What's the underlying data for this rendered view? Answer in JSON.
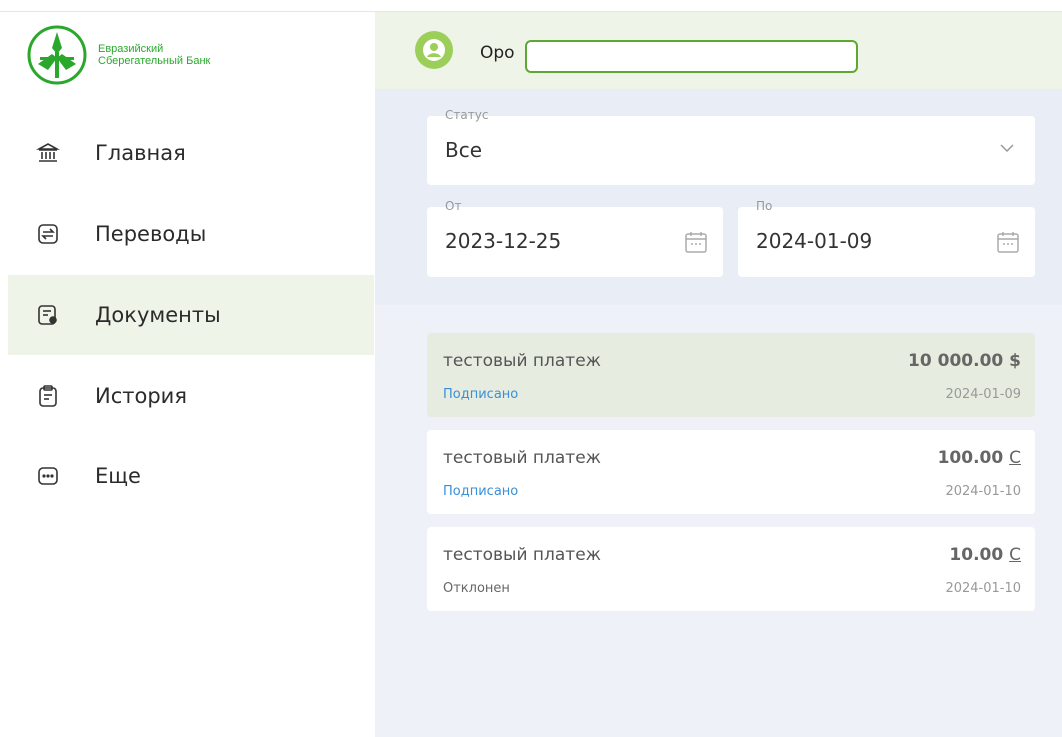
{
  "bank": {
    "name_line1": "Евразийский",
    "name_line2": "Сберегательный Банк",
    "brand_color": "#2aa82c"
  },
  "sidebar": {
    "items": [
      {
        "label": "Главная",
        "icon": "bank-icon",
        "active": false
      },
      {
        "label": "Переводы",
        "icon": "transfer-icon",
        "active": false
      },
      {
        "label": "Документы",
        "icon": "document-icon",
        "active": true
      },
      {
        "label": "История",
        "icon": "history-icon",
        "active": false
      },
      {
        "label": "Еще",
        "icon": "more-icon",
        "active": false
      }
    ]
  },
  "header": {
    "user_name": "Оро",
    "avatar_icon": "user-icon"
  },
  "filters": {
    "status": {
      "label": "Статус",
      "value": "Все"
    },
    "from": {
      "label": "От",
      "value": "2023-12-25"
    },
    "to": {
      "label": "По",
      "value": "2024-01-09"
    }
  },
  "payments": [
    {
      "title": "тестовый платеж",
      "amount": "10 000.00",
      "currency": "$",
      "status": "Подписано",
      "date": "2024-01-09",
      "selected": true
    },
    {
      "title": "тестовый платеж",
      "amount": "100.00",
      "currency": "С",
      "status": "Подписано",
      "date": "2024-01-10",
      "selected": false
    },
    {
      "title": "тестовый платеж",
      "amount": "10.00",
      "currency": "С",
      "status": "Отклонен",
      "date": "2024-01-10",
      "selected": false
    }
  ]
}
